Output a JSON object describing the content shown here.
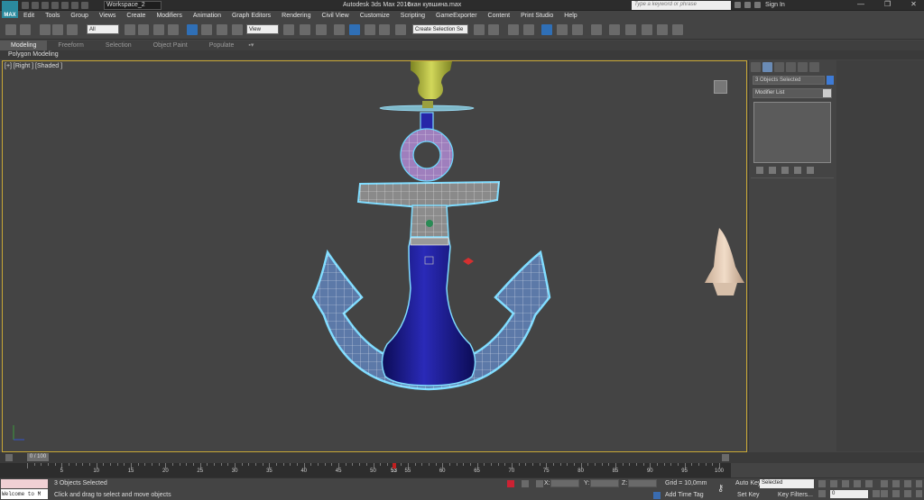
{
  "app": {
    "logo_text": "MAX",
    "workspace": "Workspace_2",
    "title": "Autodesk 3ds Max 2016",
    "file": "скан кувшина.max",
    "search_placeholder": "Type a keyword or phrase",
    "sign_in": "Sign In",
    "window_buttons": [
      "—",
      "❐",
      "✕"
    ]
  },
  "menu": [
    "Edit",
    "Tools",
    "Group",
    "Views",
    "Create",
    "Modifiers",
    "Animation",
    "Graph Editors",
    "Rendering",
    "Civil View",
    "Customize",
    "Scripting",
    "GameExporter",
    "Content",
    "Print Studio",
    "Help"
  ],
  "toolbar": {
    "filter": "All",
    "ref_coord": "View",
    "selection_set": "Create Selection Se"
  },
  "ribbon": {
    "tabs": [
      {
        "label": "Modeling",
        "active": true
      },
      {
        "label": "Freeform",
        "active": false
      },
      {
        "label": "Selection",
        "active": false
      },
      {
        "label": "Object Paint",
        "active": false
      },
      {
        "label": "Populate",
        "active": false
      }
    ],
    "sub_label": "Polygon Modeling"
  },
  "viewport": {
    "label": "[+] [Right ] [Shaded ]"
  },
  "command_panel": {
    "object_name": "3 Objects Selected",
    "object_color": "#3e7bd6",
    "modifier_list": "Modifier List"
  },
  "timeline": {
    "slider": "0 / 100",
    "current_frame": 53,
    "ticks": [
      5,
      10,
      15,
      20,
      25,
      30,
      35,
      40,
      45,
      50,
      53,
      55,
      60,
      65,
      70,
      75,
      80,
      85,
      90,
      95,
      100
    ]
  },
  "status": {
    "script_listener": "Welcome to M",
    "selection": "3 Objects Selected",
    "prompt": "Click and drag to select and move objects",
    "x_label": "X:",
    "y_label": "Y:",
    "z_label": "Z:",
    "grid": "Grid = 10,0mm",
    "add_time_tag": "Add Time Tag",
    "auto_key": "Auto Key",
    "set_key": "Set Key",
    "selected_set": "Selected",
    "key_filters": "Key Filters...",
    "frame": "0"
  },
  "colors": {
    "wire": "#ffffff",
    "select_glow": "#5fd0ff",
    "vase_blue": "#1f1f9a",
    "bowl_green": "#b8bf3e",
    "cone": "#e5cbb3"
  }
}
